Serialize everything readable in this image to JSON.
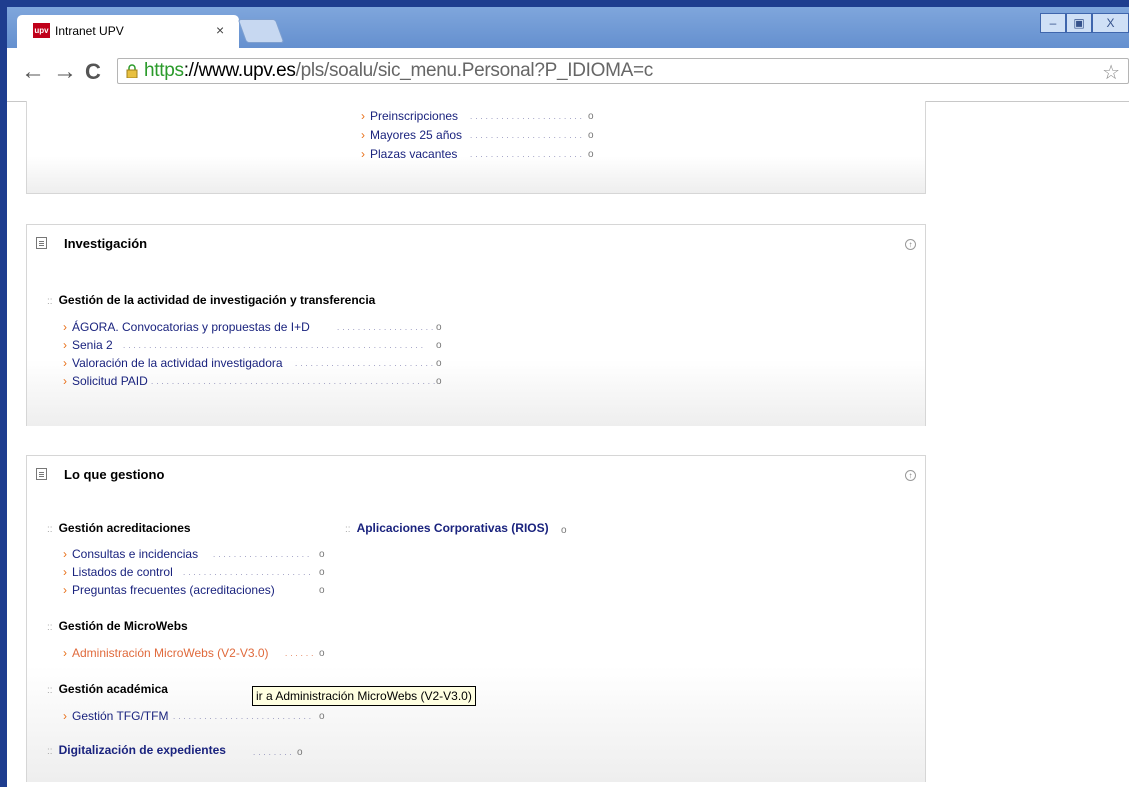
{
  "browser": {
    "tab_title": "Intranet UPV",
    "tab_close": "×",
    "favicon_text": "upv",
    "url_scheme": "https",
    "url_host": "://www.upv.es",
    "url_path": "/pls/soalu/sic_menu.Personal?P_IDIOMA=c",
    "nav_back": "←",
    "nav_forward": "→",
    "nav_reload": "C",
    "star": "☆",
    "win_minimize": "–",
    "win_restore": "▣",
    "win_close": "X"
  },
  "top_panel": {
    "items": [
      "Preinscripciones",
      "Mayores 25 años",
      "Plazas vacantes"
    ]
  },
  "investigacion": {
    "title": "Investigación",
    "group": "Gestión de la actividad de investigación y transferencia",
    "items": [
      "ÁGORA. Convocatorias y propuestas de I+D",
      "Senia 2",
      "Valoración de la actividad investigadora",
      "Solicitud PAID"
    ]
  },
  "gestiono": {
    "title": "Lo que gestiono",
    "acreditaciones": {
      "title": "Gestión acreditaciones",
      "items": [
        "Consultas e incidencias",
        "Listados de control",
        "Preguntas frecuentes (acreditaciones)"
      ]
    },
    "microwebs": {
      "title": "Gestión de MicroWebs",
      "items": [
        "Administración MicroWebs (V2-V3.0)"
      ]
    },
    "academica": {
      "title": "Gestión académica",
      "items": [
        "Gestión TFG/TFM"
      ]
    },
    "digitalizacion": "Digitalización de expedientes",
    "rios": "Aplicaciones Corporativas (RIOS)"
  },
  "tooltip": "ir a Administración MicroWebs (V2-V3.0)",
  "symbols": {
    "arrow": "›",
    "circle": "o",
    "sep": "::",
    "dots": "..........................................................",
    "collapse": "↑"
  },
  "colors": {
    "link": "#1a237e",
    "hover_link": "#e06a3c",
    "frame": "#1e3d8f",
    "secure": "#2a9a2a"
  }
}
